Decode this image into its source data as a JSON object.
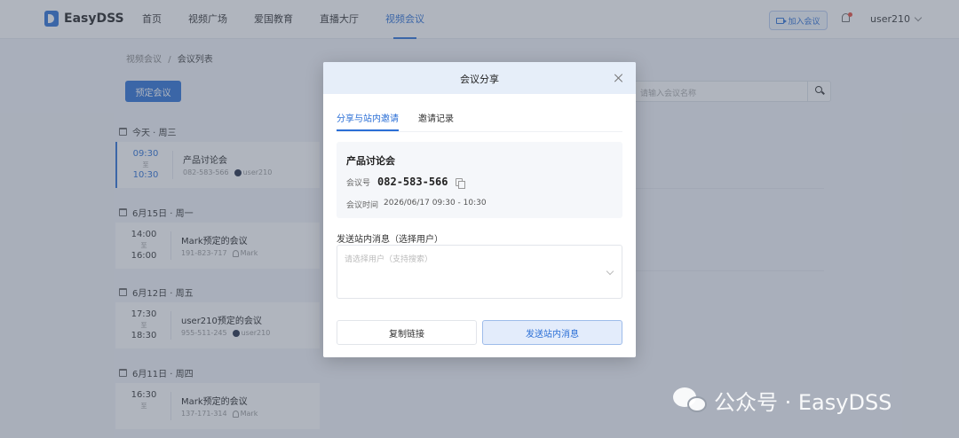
{
  "header": {
    "logo_text": "EasyDSS",
    "nav": [
      "首页",
      "视频广场",
      "爱国教育",
      "直播大厅",
      "视频会议"
    ],
    "active_nav": 4,
    "join_label": "加入会议",
    "user_name": "user210"
  },
  "breadcrumb": {
    "parent": "视频会议",
    "separator": "/",
    "current": "会议列表"
  },
  "reserve_label": "预定会议",
  "search": {
    "placeholder": "请输入会议名称"
  },
  "days": [
    {
      "label": "今天 · 周三",
      "meetings": [
        {
          "start": "09:30",
          "sep": "至",
          "end": "10:30",
          "title": "产品讨论会",
          "code": "082-583-566",
          "host": "user210"
        }
      ]
    },
    {
      "label": "6月15日 · 周一",
      "meetings": [
        {
          "start": "14:00",
          "sep": "至",
          "end": "16:00",
          "title": "Mark预定的会议",
          "code": "191-823-717",
          "host": "Mark"
        }
      ]
    },
    {
      "label": "6月12日 · 周五",
      "meetings": [
        {
          "start": "17:30",
          "sep": "至",
          "end": "18:30",
          "title": "user210预定的会议",
          "code": "955-511-245",
          "host": "user210"
        }
      ]
    },
    {
      "label": "6月11日 · 周四",
      "meetings": [
        {
          "start": "16:30",
          "sep": "至",
          "end": "",
          "title": "Mark预定的会议",
          "code": "137-171-314",
          "host": "Mark"
        }
      ]
    }
  ],
  "modal": {
    "title": "会议分享",
    "tabs": [
      "分享与站内邀请",
      "邀请记录"
    ],
    "meeting_name": "产品讨论会",
    "id_label": "会议号",
    "meeting_id": "082-583-566",
    "time_label": "会议时间",
    "meeting_time": "2026/06/17 09:30 - 10:30",
    "send_label": "发送站内消息（选择用户）",
    "select_placeholder": "请选择用户（支持搜索）",
    "copy_button": "复制链接",
    "send_button": "发送站内消息"
  },
  "watermark": {
    "text": "公众号 · EasyDSS"
  },
  "colors": {
    "accent": "#2b6fd6"
  }
}
